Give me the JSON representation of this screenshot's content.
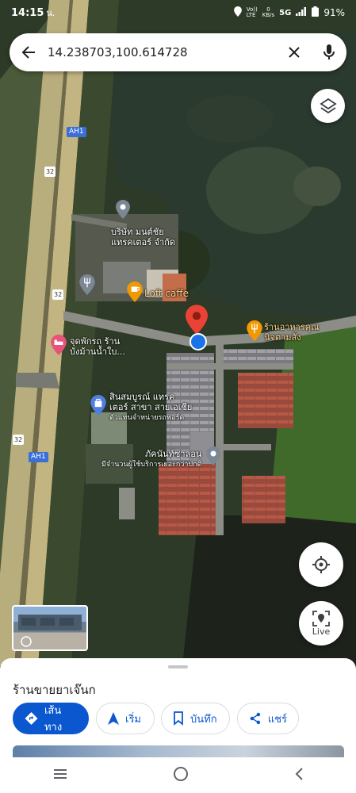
{
  "status_bar": {
    "time": "14:15",
    "dot": "น.",
    "net_label": "Vo))\nLTE",
    "speed": "0\nKB/s",
    "network": "5G",
    "battery": "91%"
  },
  "search": {
    "query": "14.238703,100.614728"
  },
  "map": {
    "road_label_ah1": "AH1",
    "road_number": "32",
    "pins": [
      {
        "name": "บริษัท มนต์ชัย\nแทรคเตอร์ จำกัด"
      },
      {
        "name": "Loft caffe"
      },
      {
        "name": "ร้านอาหารคุณ\nนิจตามสั่ง"
      },
      {
        "name": "จุดพักรถ ร้าน\nบังม้านน้ำใบ..."
      },
      {
        "name": "สินสมบูรณ์ แทรค\nเตอร์ สาขา สายเอเชีย",
        "sub": "ตัวแทนจำหน่ายรถฟอร์ด"
      },
      {
        "name": "ภัคนันท์ซาลอน",
        "sub": "มีจำนวนผู้ใช้บริการเยอะกว่าปกติ"
      }
    ],
    "live_label": "Live"
  },
  "sheet": {
    "title": "ร้านขายยาเจ๊นก",
    "actions": {
      "directions": "เส้นทาง",
      "start": "เริ่ม",
      "save": "บันทึก",
      "share": "แชร์"
    }
  },
  "colors": {
    "primary": "#0b57d0",
    "pin_red": "#ea4335",
    "location_blue": "#1a73e8"
  }
}
